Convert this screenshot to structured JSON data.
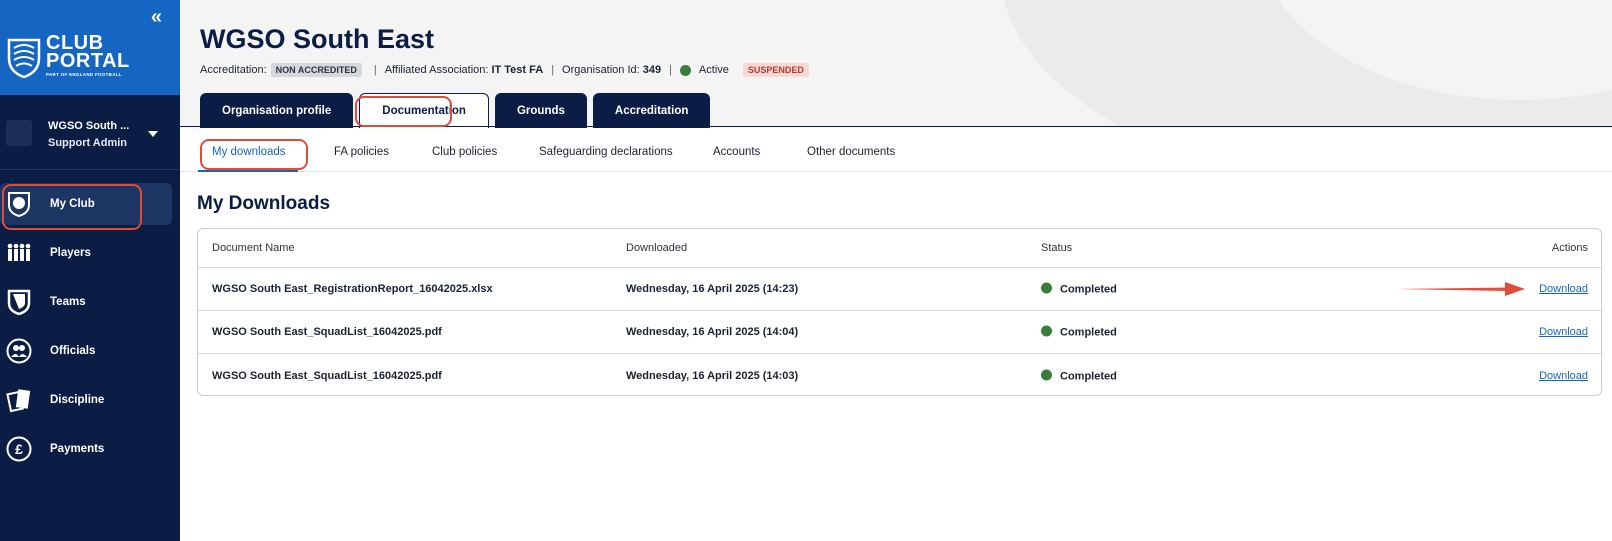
{
  "sidebar": {
    "collapse_label": "«",
    "logo_line1": "CLUB",
    "logo_line2": "PORTAL",
    "logo_sub": "PART OF ENGLAND FOOTBALL",
    "user": {
      "name": "WGSO South ...",
      "role": "Support Admin"
    },
    "items": [
      {
        "label": "My Club",
        "icon": "club-shield-icon"
      },
      {
        "label": "Players",
        "icon": "players-icon"
      },
      {
        "label": "Teams",
        "icon": "teams-shield-icon"
      },
      {
        "label": "Officials",
        "icon": "officials-icon"
      },
      {
        "label": "Discipline",
        "icon": "cards-icon"
      },
      {
        "label": "Payments",
        "icon": "pound-icon"
      }
    ]
  },
  "header": {
    "title": "WGSO South East",
    "accreditation_label": "Accreditation:",
    "accreditation_value": "NON ACCREDITED",
    "association_label": "Affiliated Association:",
    "association_value": "IT Test FA",
    "org_id_label": "Organisation Id:",
    "org_id_value": "349",
    "status_label": "Active",
    "suspended_label": "SUSPENDED",
    "separator": "|",
    "tabs": [
      {
        "label": "Organisation profile"
      },
      {
        "label": "Documentation"
      },
      {
        "label": "Grounds"
      },
      {
        "label": "Accreditation"
      }
    ]
  },
  "subtabs": [
    {
      "label": "My downloads"
    },
    {
      "label": "FA policies"
    },
    {
      "label": "Club policies"
    },
    {
      "label": "Safeguarding declarations"
    },
    {
      "label": "Accounts"
    },
    {
      "label": "Other documents"
    }
  ],
  "main": {
    "section_title": "My Downloads",
    "columns": [
      "Document Name",
      "Downloaded",
      "Status",
      "Actions"
    ],
    "rows": [
      {
        "name": "WGSO South East_RegistrationReport_16042025.xlsx",
        "downloaded": "Wednesday, 16 April 2025 (14:23)",
        "status": "Completed",
        "action": "Download"
      },
      {
        "name": "WGSO South East_SquadList_16042025.pdf",
        "downloaded": "Wednesday, 16 April 2025 (14:04)",
        "status": "Completed",
        "action": "Download"
      },
      {
        "name": "WGSO South East_SquadList_16042025.pdf",
        "downloaded": "Wednesday, 16 April 2025 (14:03)",
        "status": "Completed",
        "action": "Download"
      }
    ]
  },
  "colors": {
    "sidebar_bg": "#0b1d45",
    "brand_blue": "#1566c2",
    "annotation_red": "#e04b3a",
    "status_green": "#3a7d3a"
  }
}
